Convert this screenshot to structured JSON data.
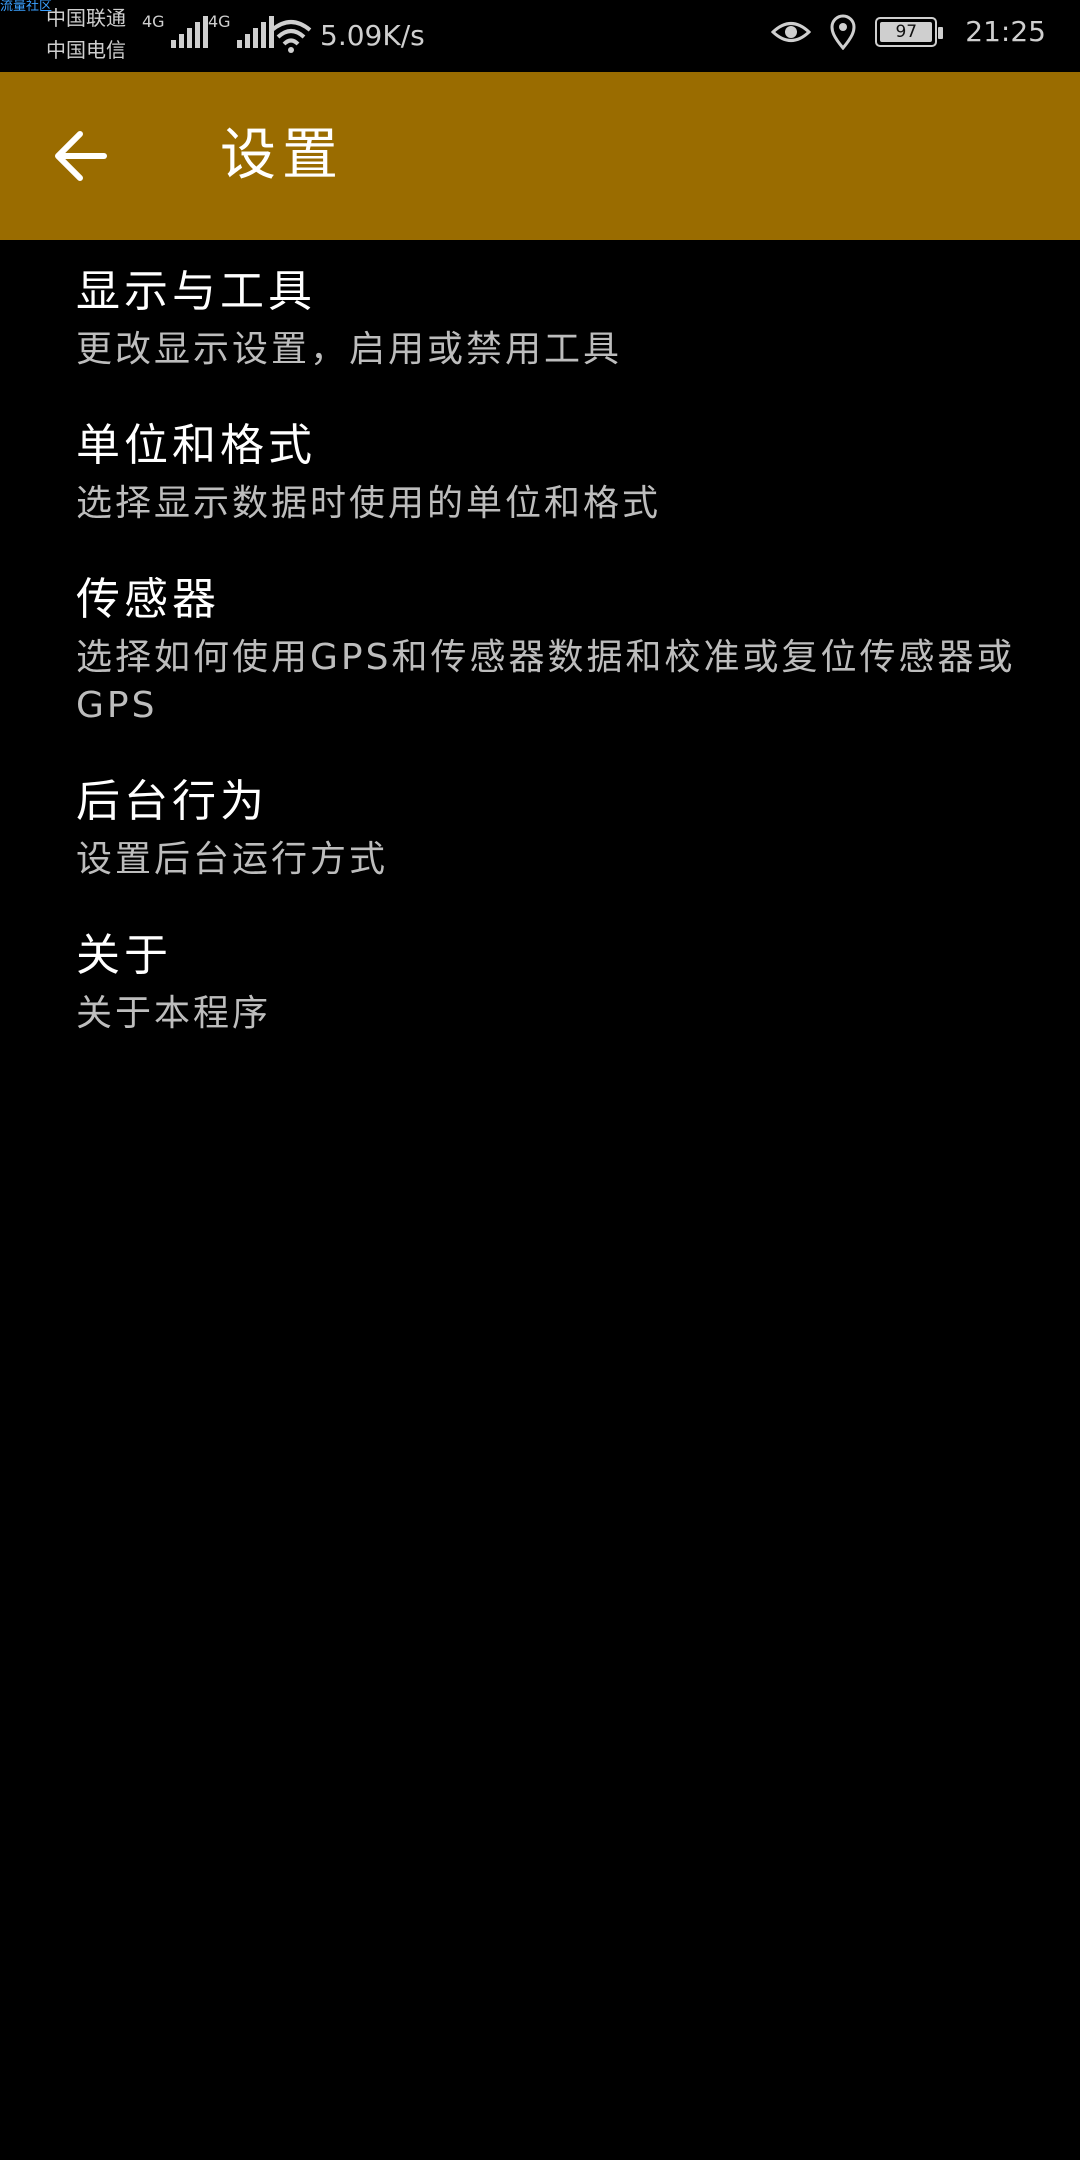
{
  "status_bar": {
    "watermark": "流量社区",
    "carrier_1": "中国联通",
    "carrier_2": "中国电信",
    "network_1": "4G",
    "network_2": "4G",
    "net_speed": "5.09K/s",
    "battery_level": "97",
    "time": "21:25",
    "icons": [
      "signal-icon",
      "signal-icon",
      "wifi-icon",
      "eye-icon",
      "location-icon",
      "battery-icon"
    ]
  },
  "app_bar": {
    "title": "设置",
    "back_icon": "arrow-back-icon",
    "color": "#9a6c00"
  },
  "settings": {
    "items": [
      {
        "title": "显示与工具",
        "subtitle": "更改显示设置，启用或禁用工具"
      },
      {
        "title": "单位和格式",
        "subtitle": "选择显示数据时使用的单位和格式"
      },
      {
        "title": "传感器",
        "subtitle": "选择如何使用GPS和传感器数据和校准或复位传感器或GPS"
      },
      {
        "title": "后台行为",
        "subtitle": "设置后台运行方式"
      },
      {
        "title": "关于",
        "subtitle": "关于本程序"
      }
    ]
  }
}
